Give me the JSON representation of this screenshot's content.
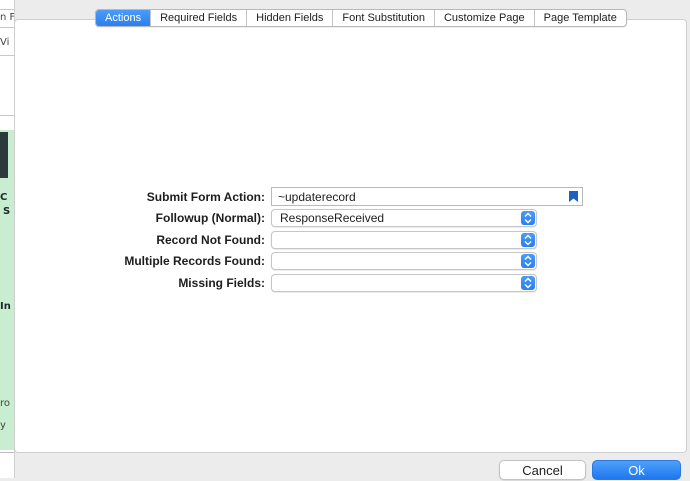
{
  "background_app": {
    "fragments": [
      "n F",
      "Vi",
      "C",
      "S",
      "In",
      "ro",
      "y"
    ]
  },
  "tabs": [
    {
      "label": "Actions",
      "active": true
    },
    {
      "label": "Required Fields",
      "active": false
    },
    {
      "label": "Hidden Fields",
      "active": false
    },
    {
      "label": "Font Substitution",
      "active": false
    },
    {
      "label": "Customize Page",
      "active": false
    },
    {
      "label": "Page Template",
      "active": false
    }
  ],
  "form": {
    "submit_action": {
      "label": "Submit Form Action:",
      "value": "~updaterecord",
      "icon": "bookmark-icon"
    },
    "followup": {
      "label": "Followup (Normal):",
      "value": "ResponseReceived"
    },
    "record_not_found": {
      "label": "Record Not Found:",
      "value": ""
    },
    "multiple_records": {
      "label": "Multiple Records Found:",
      "value": ""
    },
    "missing_fields": {
      "label": "Missing Fields:",
      "value": ""
    }
  },
  "buttons": {
    "cancel": "Cancel",
    "ok": "Ok"
  },
  "colors": {
    "accent": "#2b7ff0",
    "bookmark": "#1f5fbf",
    "background_green": "#c9edd0"
  }
}
